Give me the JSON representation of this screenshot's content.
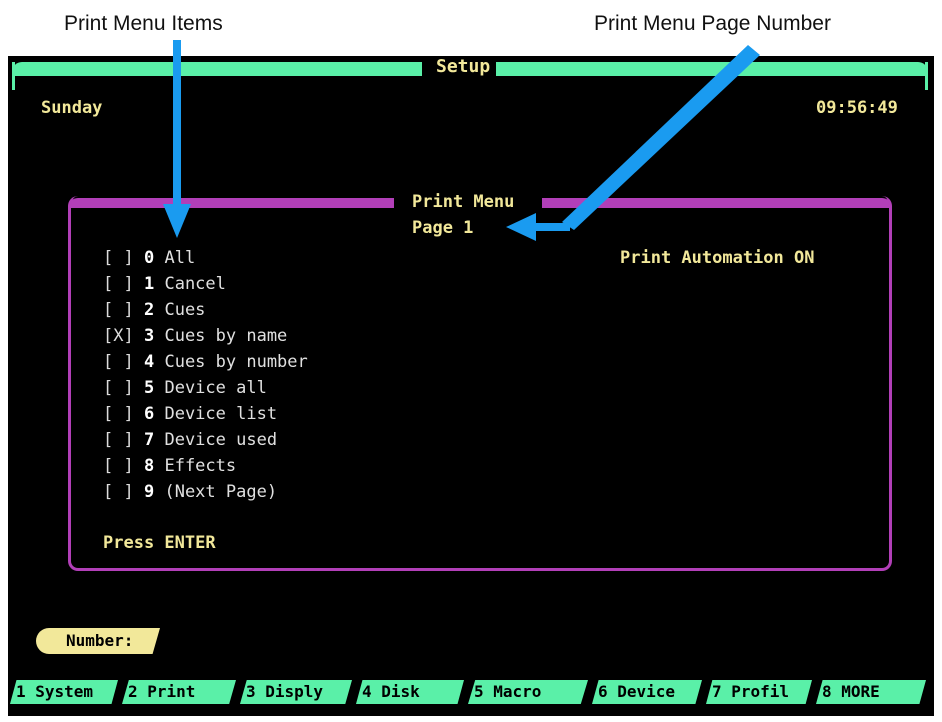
{
  "annotations": {
    "items_label": "Print Menu Items",
    "page_number_label": "Print Menu Page Number"
  },
  "header": {
    "title": "Setup",
    "day": "Sunday",
    "time": "09:56:49"
  },
  "menu": {
    "title": "Print Menu",
    "page": "Page 1",
    "status": "Print Automation ON",
    "items": [
      {
        "box": "[ ]",
        "num": "0",
        "label": "All"
      },
      {
        "box": "[ ]",
        "num": "1",
        "label": "Cancel"
      },
      {
        "box": "[ ]",
        "num": "2",
        "label": "Cues"
      },
      {
        "box": "[X]",
        "num": "3",
        "label": "Cues by name"
      },
      {
        "box": "[ ]",
        "num": "4",
        "label": "Cues by number"
      },
      {
        "box": "[ ]",
        "num": "5",
        "label": "Device all"
      },
      {
        "box": "[ ]",
        "num": "6",
        "label": "Device list"
      },
      {
        "box": "[ ]",
        "num": "7",
        "label": "Device used"
      },
      {
        "box": "[ ]",
        "num": "8",
        "label": "Effects"
      },
      {
        "box": "[ ]",
        "num": "9",
        "label": "(Next Page)"
      }
    ],
    "prompt": "Press ENTER"
  },
  "input": {
    "label": "Number:"
  },
  "function_keys": [
    "1 System",
    "2 Print",
    "3 Disply",
    "4 Disk",
    "5 Macro",
    "6 Device",
    "7 Profil",
    "8 MORE"
  ],
  "colors": {
    "bar": "#5af0a8",
    "menu_border": "#b23fb8",
    "highlight_text": "#f2e89a",
    "arrow": "#1a9bf0"
  }
}
